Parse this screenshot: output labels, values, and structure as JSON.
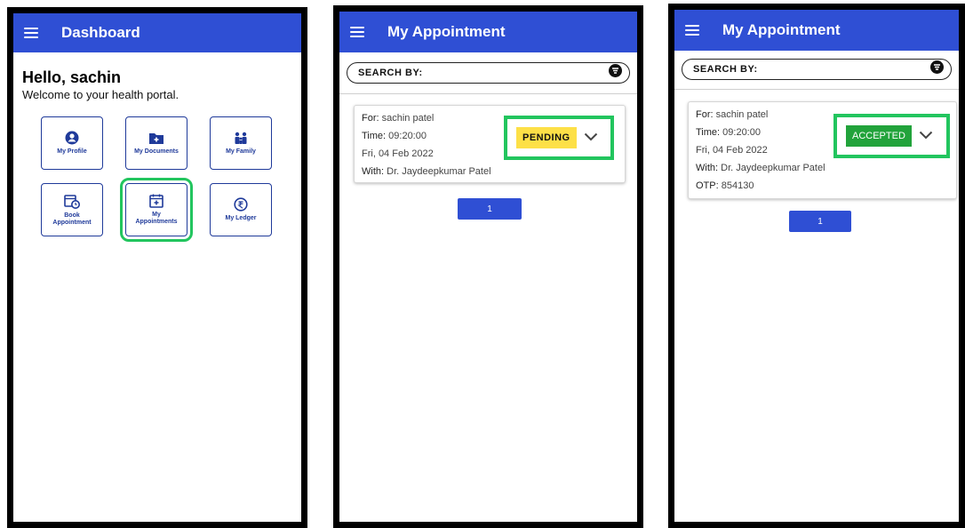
{
  "screen1": {
    "title": "Dashboard",
    "greeting": "Hello, sachin",
    "welcome": "Welcome to your health portal.",
    "tiles": [
      {
        "label": "My Profile",
        "icon": "person-icon"
      },
      {
        "label": "My Documents",
        "icon": "folder-plus-icon"
      },
      {
        "label": "My Family",
        "icon": "family-icon"
      },
      {
        "label": "Book Appointment",
        "icon": "calendar-clock-icon"
      },
      {
        "label": "My Appointments",
        "icon": "calendar-plus-icon",
        "highlighted": true
      },
      {
        "label": "My Ledger",
        "icon": "rupee-icon"
      }
    ]
  },
  "screen2": {
    "title": "My Appointment",
    "search_label": "SEARCH BY:",
    "appointment": {
      "for_label": "For:",
      "for_value": "sachin patel",
      "time_label": "Time:",
      "time_value": "09:20:00",
      "date": "Fri, 04 Feb 2022",
      "with_label": "With:",
      "with_value": "Dr. Jaydeepkumar Patel",
      "status": "PENDING"
    },
    "page": "1"
  },
  "screen3": {
    "title": "My Appointment",
    "search_label": "SEARCH BY:",
    "appointment": {
      "for_label": "For:",
      "for_value": "sachin patel",
      "time_label": "Time:",
      "time_value": "09:20:00",
      "date": "Fri, 04 Feb 2022",
      "with_label": "With:",
      "with_value": "Dr. Jaydeepkumar Patel",
      "otp_label": "OTP:",
      "otp_value": "854130",
      "status": "ACCEPTED"
    },
    "page": "1"
  },
  "colors": {
    "topbar": "#2f4fd4",
    "highlight": "#22c55e",
    "pending": "#fde047",
    "accepted": "#22a33b"
  }
}
